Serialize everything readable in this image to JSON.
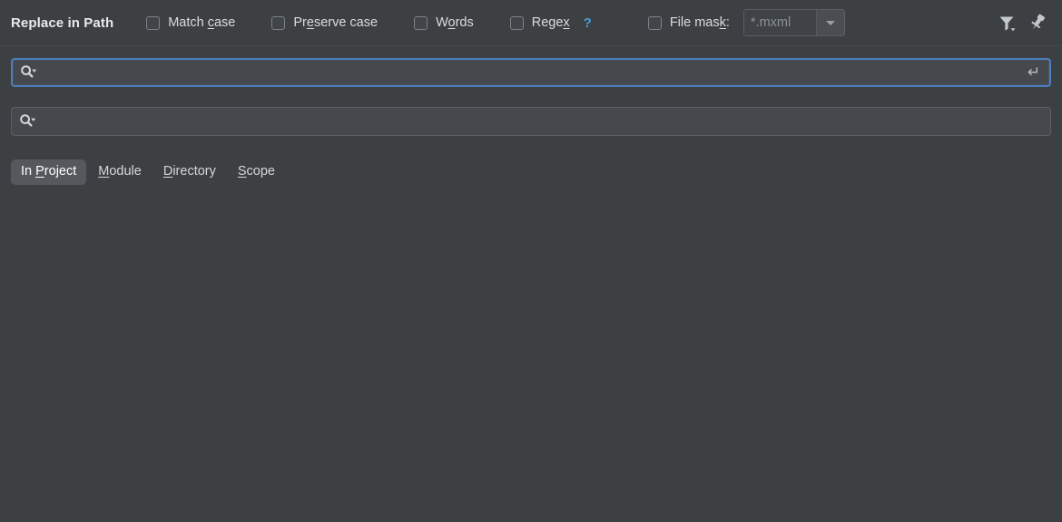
{
  "window": {
    "title": "Replace in Path",
    "background_color": "#3c4043",
    "accent_color": "#4a7ebb",
    "link_color": "#4a9bd8"
  },
  "toolbar": {
    "options": [
      {
        "id": "match-case",
        "label_before": "Match ",
        "mnemonic": "c",
        "label_after": "ase",
        "checked": false
      },
      {
        "id": "preserve-case",
        "label_before": "Pr",
        "mnemonic": "e",
        "label_after": "serve case",
        "checked": false
      },
      {
        "id": "words",
        "label_before": "W",
        "mnemonic": "o",
        "label_after": "rds",
        "checked": false
      },
      {
        "id": "regex",
        "label_before": "Rege",
        "mnemonic": "x",
        "label_after": "",
        "checked": false
      }
    ],
    "regex_help_label": "?",
    "file_mask": {
      "label_before": "File mas",
      "mnemonic": "k",
      "label_after": ":",
      "checked": false,
      "value": "*.mxml",
      "enabled": false
    },
    "filter_button_name": "filter-icon",
    "pin_button_name": "pin-icon"
  },
  "search_field": {
    "value": "",
    "placeholder": "",
    "focused": true,
    "icon": "search-icon",
    "enter_hint": "↵"
  },
  "replace_field": {
    "value": "",
    "placeholder": "",
    "focused": false,
    "icon": "search-icon"
  },
  "scope": {
    "tabs": [
      {
        "id": "in-project",
        "label_before": "In ",
        "mnemonic": "P",
        "label_after": "roject",
        "selected": true
      },
      {
        "id": "module",
        "label_before": "",
        "mnemonic": "M",
        "label_after": "odule",
        "selected": false
      },
      {
        "id": "directory",
        "label_before": "",
        "mnemonic": "D",
        "label_after": "irectory",
        "selected": false
      },
      {
        "id": "scope",
        "label_before": "",
        "mnemonic": "S",
        "label_after": "cope",
        "selected": false
      }
    ]
  },
  "results": {
    "empty": true,
    "text": ""
  }
}
